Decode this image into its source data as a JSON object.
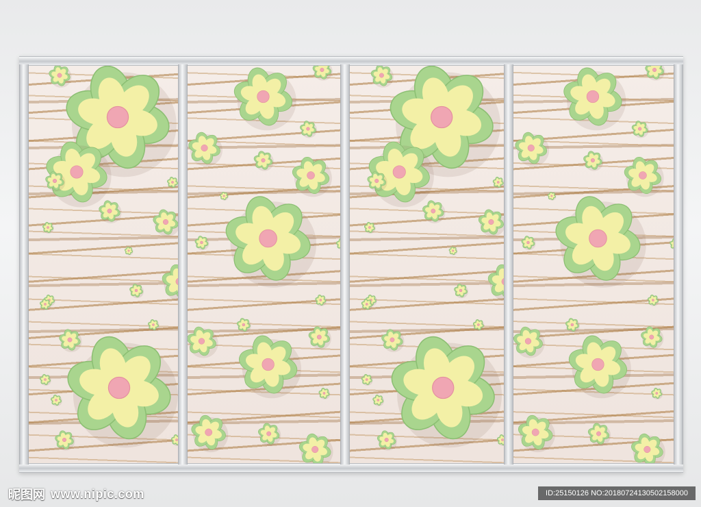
{
  "watermark": {
    "logo_text": "昵图网",
    "site_url": "www.nipic.com",
    "id_text": "ID:25150126 NO:20180724130502158000"
  },
  "colors": {
    "petal_outer": "#a9d58e",
    "petal_inner": "#f3f0a6",
    "center": "#f0a6b3",
    "frame": "#d7d9dc",
    "panel_bg": "#f2e9e3",
    "stripe": "#b07a3c"
  },
  "panels": [
    {
      "name": "panel-1",
      "pattern": "A"
    },
    {
      "name": "panel-2",
      "pattern": "B"
    },
    {
      "name": "panel-3",
      "pattern": "A"
    },
    {
      "name": "panel-4",
      "pattern": "B"
    }
  ]
}
